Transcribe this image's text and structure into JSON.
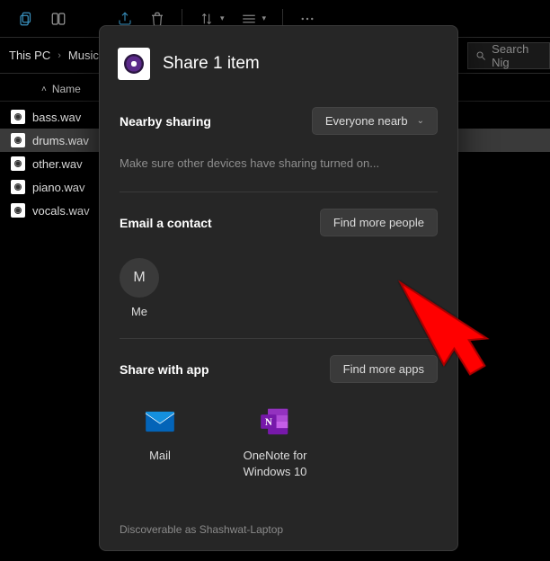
{
  "toolbar": {
    "icons": [
      "copy-icon",
      "two-pane-icon",
      "share-icon",
      "delete-icon",
      "sort-icon",
      "view-icon",
      "more-icon"
    ]
  },
  "breadcrumb": {
    "items": [
      "This PC",
      "Music"
    ]
  },
  "search": {
    "placeholder": "Search Nig"
  },
  "list": {
    "header": {
      "name": "Name"
    },
    "files": [
      {
        "name": "bass.wav",
        "selected": false
      },
      {
        "name": "drums.wav",
        "selected": true
      },
      {
        "name": "other.wav",
        "selected": false
      },
      {
        "name": "piano.wav",
        "selected": false
      },
      {
        "name": "vocals.wav",
        "selected": false
      }
    ]
  },
  "share": {
    "title": "Share 1 item",
    "nearby": {
      "label": "Nearby sharing",
      "dropdown": "Everyone nearb",
      "hint": "Make sure other devices have sharing turned on..."
    },
    "email": {
      "label": "Email a contact",
      "button": "Find more people",
      "contacts": [
        {
          "initial": "M",
          "name": "Me"
        }
      ]
    },
    "app": {
      "label": "Share with app",
      "button": "Find more apps",
      "apps": [
        {
          "name": "Mail",
          "kind": "mail"
        },
        {
          "name": "OneNote for Windows 10",
          "kind": "onenote"
        }
      ]
    },
    "footer": "Discoverable as Shashwat-Laptop"
  }
}
